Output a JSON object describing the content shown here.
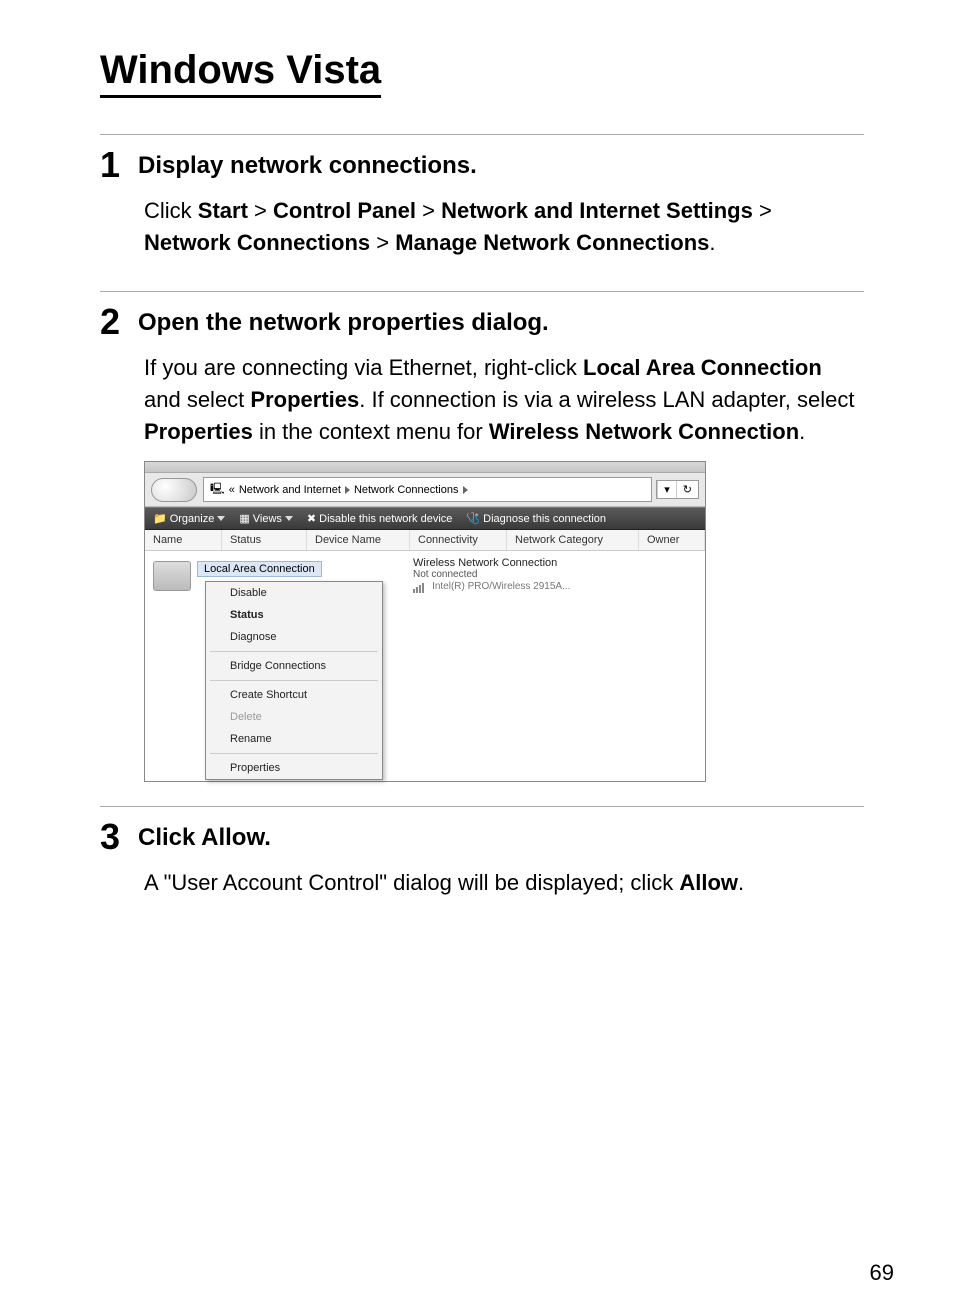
{
  "title": "Windows Vista",
  "page_number": "69",
  "steps": [
    {
      "num": "1",
      "heading": "Display network connections.",
      "para_pre": "Click ",
      "nav": [
        "Start",
        "Control Panel",
        "Network and Internet Settings",
        "Network Connections",
        "Manage Network Connections"
      ],
      "para_post": "."
    },
    {
      "num": "2",
      "heading": "Open the network properties dialog.",
      "p2_a": "If you are connecting via Ethernet, right-click ",
      "p2_b": "Local Area Connection",
      "p2_c": " and select ",
      "p2_d": "Properties",
      "p2_e": ". If connection is via a wireless LAN adapter, select ",
      "p2_f": "Properties",
      "p2_g": " in the context menu for ",
      "p2_h": "Wireless Network Connection",
      "p2_i": "."
    },
    {
      "num": "3",
      "heading_pre": "Click ",
      "heading_bold": "Allow",
      "heading_post": ".",
      "p3_a": "A \"User Account Control\" dialog will be displayed; click ",
      "p3_b": "Allow",
      "p3_c": "."
    }
  ],
  "vista": {
    "breadcrumb": {
      "b1": "«",
      "b2": "Network and Internet",
      "b3": "Network Connections"
    },
    "addr_dd": "▾",
    "addr_refresh": "↻",
    "toolbar": {
      "organize": "Organize",
      "views": "Views",
      "disable": "Disable this network device",
      "diagnose": "Diagnose this connection"
    },
    "columns": {
      "name": "Name",
      "status": "Status",
      "device": "Device Name",
      "connectivity": "Connectivity",
      "category": "Network Category",
      "owner": "Owner"
    },
    "lan_label": "Local Area Connection",
    "context_menu": {
      "disable": "Disable",
      "status": "Status",
      "diagnose": "Diagnose",
      "bridge": "Bridge Connections",
      "shortcut": "Create Shortcut",
      "delete": "Delete",
      "rename": "Rename",
      "properties": "Properties"
    },
    "wireless": {
      "name": "Wireless Network Connection",
      "status": "Not connected",
      "device": "Intel(R) PRO/Wireless 2915A..."
    }
  },
  "gt": ">"
}
